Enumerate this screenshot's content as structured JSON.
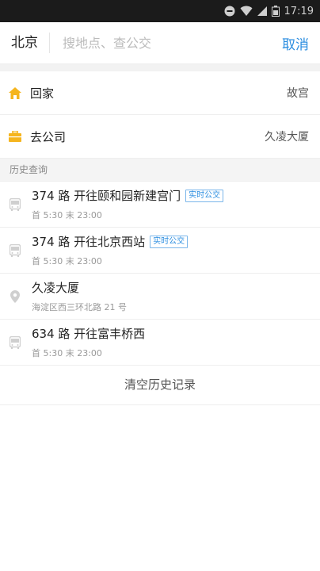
{
  "status_bar": {
    "time": "17:19"
  },
  "header": {
    "city": "北京",
    "search_placeholder": "搜地点、查公交",
    "cancel_label": "取消"
  },
  "shortcuts": [
    {
      "label": "回家",
      "value": "故宫",
      "icon": "home-icon"
    },
    {
      "label": "去公司",
      "value": "久凌大厦",
      "icon": "briefcase-icon"
    }
  ],
  "history": {
    "header": "历史查询",
    "items": [
      {
        "title": "374 路  开往颐和园新建宫门",
        "badge": "实时公交",
        "sub": "首 5:30    末 23:00",
        "icon": "bus-icon"
      },
      {
        "title": "374 路  开往北京西站",
        "badge": "实时公交",
        "sub": "首 5:30    末 23:00",
        "icon": "bus-icon"
      },
      {
        "title": "久凌大厦",
        "badge": "",
        "sub": "海淀区西三环北路 21 号",
        "icon": "location-pin-icon"
      },
      {
        "title": "634 路  开往富丰桥西",
        "badge": "",
        "sub": "首 5:30    末 23:00",
        "icon": "bus-icon"
      }
    ],
    "clear_label": "清空历史记录"
  },
  "colors": {
    "accent": "#2a8de0",
    "home_icon": "#f5b51f",
    "muted_icon": "#cfcfcf"
  }
}
